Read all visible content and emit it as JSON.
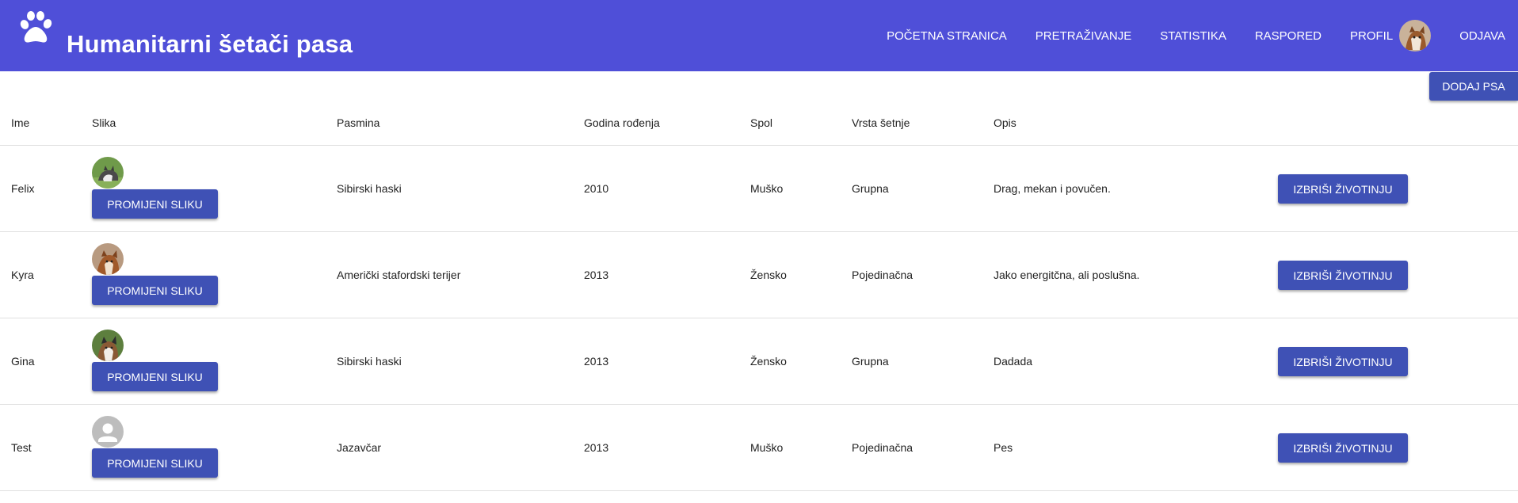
{
  "header": {
    "title": "Humanitarni šetači pasa",
    "nav": [
      "POČETNA STRANICA",
      "PRETRAŽIVANJE",
      "STATISTIKA",
      "RASPORED",
      "PROFIL",
      "ODJAVA"
    ]
  },
  "actions": {
    "add_dog": "DODAJ PSA"
  },
  "table": {
    "columns": [
      "Ime",
      "Slika",
      "Pasmina",
      "Godina rođenja",
      "Spol",
      "Vrsta šetnje",
      "Opis"
    ],
    "rows": [
      {
        "ime": "Felix",
        "pasmina": "Sibirski haski",
        "godina": "2010",
        "spol": "Muško",
        "vrsta": "Grupna",
        "opis": "Drag, mekan i povučen.",
        "change_label": "PROMIJENI SLIKU",
        "delete_label": "IZBRIŠI ŽIVOTINJU"
      },
      {
        "ime": "Kyra",
        "pasmina": "Američki stafordski terijer",
        "godina": "2013",
        "spol": "Žensko",
        "vrsta": "Pojedinačna",
        "opis": "Jako energitčna, ali poslušna.",
        "change_label": "PROMIJENI SLIKU",
        "delete_label": "IZBRIŠI ŽIVOTINJU"
      },
      {
        "ime": "Gina",
        "pasmina": "Sibirski haski",
        "godina": "2013",
        "spol": "Žensko",
        "vrsta": "Grupna",
        "opis": "Dadada",
        "change_label": "PROMIJENI SLIKU",
        "delete_label": "IZBRIŠI ŽIVOTINJU"
      },
      {
        "ime": "Test",
        "pasmina": "Jazavčar",
        "godina": "2013",
        "spol": "Muško",
        "vrsta": "Pojedinačna",
        "opis": "Pes",
        "change_label": "PROMIJENI SLIKU",
        "delete_label": "IZBRIŠI ŽIVOTINJU"
      }
    ]
  },
  "icons": {
    "logo": "paw-icon",
    "row_images": [
      "dog-photo-husky",
      "dog-photo-terrier",
      "dog-photo-husky-brown",
      "default-avatar-icon"
    ],
    "profile": "profile-avatar"
  },
  "colors": {
    "header": "#4f4fd8",
    "button": "#3f51b5"
  }
}
